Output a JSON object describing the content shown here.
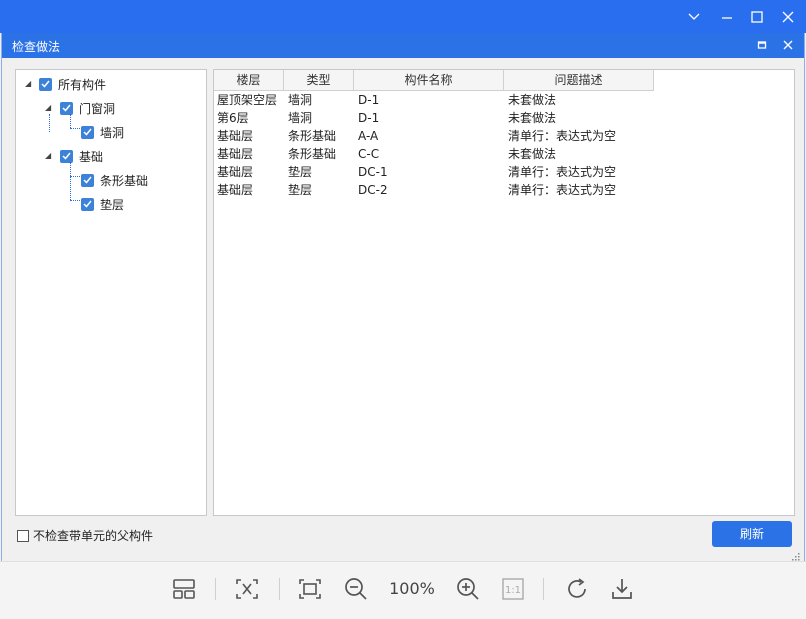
{
  "window": {
    "controls": [
      "chevron-down",
      "minimize",
      "maximize",
      "close"
    ]
  },
  "dialog": {
    "title": "检查做法",
    "controls": [
      "restore",
      "close"
    ]
  },
  "tree": {
    "root": {
      "label": "所有构件",
      "checked": true
    },
    "groups": [
      {
        "label": "门窗洞",
        "checked": true,
        "children": [
          {
            "label": "墙洞",
            "checked": true
          }
        ]
      },
      {
        "label": "基础",
        "checked": true,
        "children": [
          {
            "label": "条形基础",
            "checked": true
          },
          {
            "label": "垫层",
            "checked": true
          }
        ]
      }
    ]
  },
  "grid": {
    "columns": [
      "楼层",
      "类型",
      "构件名称",
      "问题描述"
    ],
    "rows": [
      [
        "屋顶架空层",
        "墙洞",
        "D-1",
        "未套做法"
      ],
      [
        "第6层",
        "墙洞",
        "D-1",
        "未套做法"
      ],
      [
        "基础层",
        "条形基础",
        "A-A",
        "清单行：表达式为空"
      ],
      [
        "基础层",
        "条形基础",
        "C-C",
        "未套做法"
      ],
      [
        "基础层",
        "垫层",
        "DC-1",
        "清单行：表达式为空"
      ],
      [
        "基础层",
        "垫层",
        "DC-2",
        "清单行：表达式为空"
      ]
    ]
  },
  "footer": {
    "checkbox_label": "不检查带单元的父构件",
    "checkbox_checked": false,
    "refresh_label": "刷新"
  },
  "toolbar": {
    "zoom": "100%",
    "icons": [
      "layout-icon",
      "fit-selection-icon",
      "fit-screen-icon",
      "zoom-out-icon",
      "zoom-in-icon",
      "actual-size-icon",
      "rotate-icon",
      "download-icon"
    ]
  },
  "colors": {
    "titlebar": "#2a6ef0",
    "accent": "#2b72e6",
    "checkbox": "#3b82d8"
  }
}
